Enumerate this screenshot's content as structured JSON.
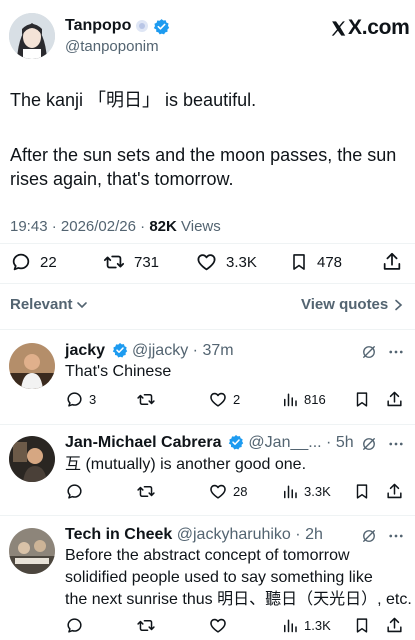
{
  "header": {
    "display_name": "Tanpopo",
    "handle": "@tanpoponim",
    "site": "X.com"
  },
  "tweet": {
    "line1": "The kanji 「明日」 is beautiful.",
    "line2": "After the sun sets and the moon passes, the sun",
    "line3": "rises again, that's tomorrow.",
    "time": "19:43",
    "date": "2026/02/26",
    "views_count": "82K",
    "views_label": "Views",
    "replies": "22",
    "reposts": "731",
    "likes": "3.3K",
    "bookmarks": "478"
  },
  "filters": {
    "relevant": "Relevant",
    "view_quotes": "View quotes"
  },
  "replies": [
    {
      "name": "jacky",
      "handle": "@jjacky",
      "time": "37m",
      "text": "That's Chinese",
      "replies": "3",
      "reposts": "",
      "likes": "2",
      "views": "816"
    },
    {
      "name": "Jan-Michael Cabrera",
      "handle": "@Jan__...",
      "time": "5h",
      "text": "互 (mutually) is another good one.",
      "replies": "",
      "reposts": "",
      "likes": "28",
      "views": "3.3K"
    },
    {
      "name": "Tech in Cheek",
      "handle": "@jackyharuhiko",
      "time": "2h",
      "text_line1": "Before the abstract concept of tomorrow",
      "text_line2": "solidified people used to say something like",
      "text_line3": "the next sunrise thus 明日、聽日（天光日）, etc.",
      "views": "1.3K"
    }
  ],
  "colors": {
    "verified": "#1d9bf0",
    "text": "#0f1419",
    "secondary": "#536471",
    "divider": "#eff3f4"
  }
}
